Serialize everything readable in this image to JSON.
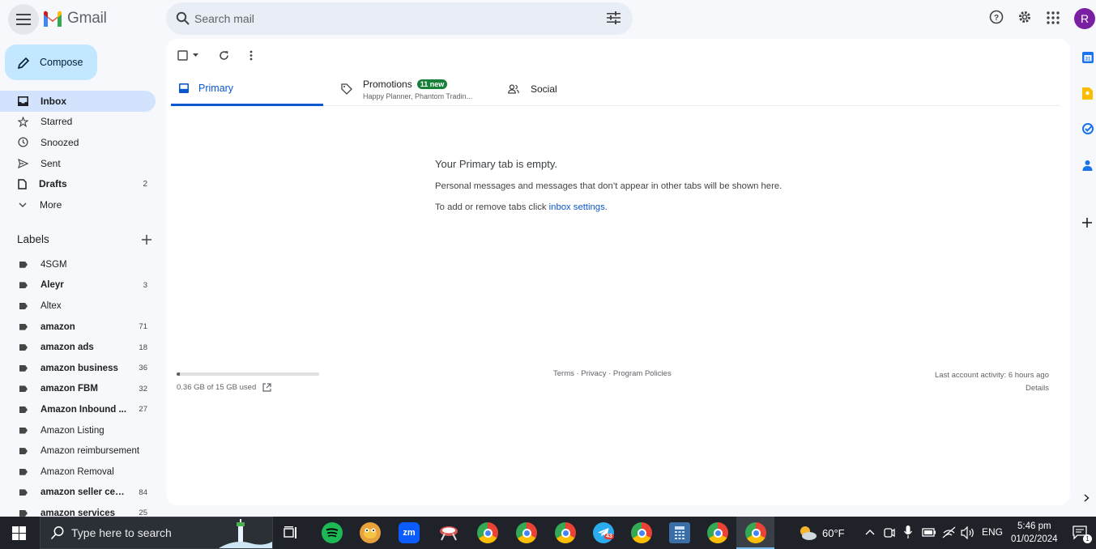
{
  "header": {
    "app_name": "Gmail",
    "search_placeholder": "Search mail",
    "avatar_initial": "R"
  },
  "sidebar": {
    "compose_label": "Compose",
    "items": [
      {
        "label": "Inbox",
        "count": "",
        "icon": "inbox-icon",
        "active": true
      },
      {
        "label": "Starred",
        "count": "",
        "icon": "star-icon"
      },
      {
        "label": "Snoozed",
        "count": "",
        "icon": "clock-icon"
      },
      {
        "label": "Sent",
        "count": "",
        "icon": "send-icon"
      },
      {
        "label": "Drafts",
        "count": "2",
        "icon": "draft-icon",
        "bold": true
      },
      {
        "label": "More",
        "count": "",
        "icon": "chevron-down-icon"
      }
    ],
    "labels_heading": "Labels",
    "labels": [
      {
        "label": "4SGM",
        "count": ""
      },
      {
        "label": "Aleyr",
        "count": "3",
        "bold": true
      },
      {
        "label": "Altex",
        "count": ""
      },
      {
        "label": "amazon",
        "count": "71",
        "bold": true
      },
      {
        "label": "amazon ads",
        "count": "18",
        "bold": true
      },
      {
        "label": "amazon business",
        "count": "36",
        "bold": true
      },
      {
        "label": "amazon FBM",
        "count": "32",
        "bold": true
      },
      {
        "label": "Amazon Inbound ...",
        "count": "27",
        "bold": true
      },
      {
        "label": "Amazon Listing",
        "count": ""
      },
      {
        "label": "Amazon reimbursement",
        "count": ""
      },
      {
        "label": "Amazon Removal",
        "count": ""
      },
      {
        "label": "amazon seller cen...",
        "count": "84",
        "bold": true
      },
      {
        "label": "amazon services",
        "count": "25",
        "bold": true
      }
    ]
  },
  "tabs": {
    "primary": "Primary",
    "promotions": "Promotions",
    "promotions_badge": "11 new",
    "promotions_snippet": "Happy Planner, Phantom Tradin...",
    "social": "Social"
  },
  "empty_state": {
    "title": "Your Primary tab is empty.",
    "line1": "Personal messages and messages that don’t appear in other tabs will be shown here.",
    "line2_prefix": "To add or remove tabs click ",
    "line2_link": "inbox settings",
    "line2_suffix": "."
  },
  "footer": {
    "storage_text": "0.36 GB of 15 GB used",
    "storage_fraction": 0.024,
    "links": "Terms · Privacy · Program Policies",
    "last_activity": "Last account activity: 6 hours ago",
    "details": "Details"
  },
  "taskbar": {
    "search_placeholder": "Type here to search",
    "weather": "60°F",
    "language": "ENG",
    "time": "5:46 pm",
    "date": "01/02/2024",
    "notification_count": "1",
    "telegram_badge": "43"
  },
  "colors": {
    "accent": "#0b57d0",
    "compose_bg": "#c2e7ff",
    "active_nav": "#d3e3fd",
    "badge_green": "#188038"
  }
}
